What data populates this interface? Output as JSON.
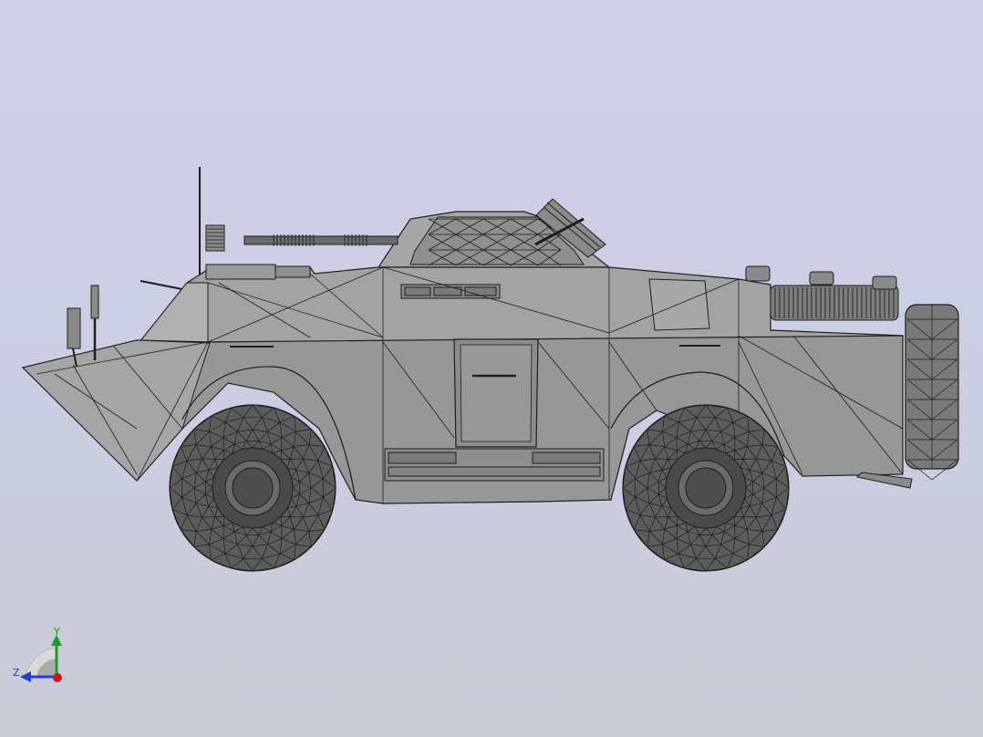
{
  "viewport": {
    "background_top": "#d0d0e9",
    "background_bottom": "#c9cbd6"
  },
  "model": {
    "name": "armored-vehicle",
    "display_mode": "shaded-with-edges",
    "view": "side",
    "colors": {
      "body": "#9a9a9a",
      "body_light": "#b4b4b4",
      "body_dark": "#7e7e7e",
      "tire": "#5a5a5a",
      "tire_dark": "#3e3e3e",
      "edge": "#1e1e1e"
    }
  },
  "triad": {
    "y_label": "Y",
    "z_label": "Z",
    "y_color": "#1c9a2a",
    "z_color": "#1f3fd6",
    "x_color": "#cc1a1a"
  }
}
